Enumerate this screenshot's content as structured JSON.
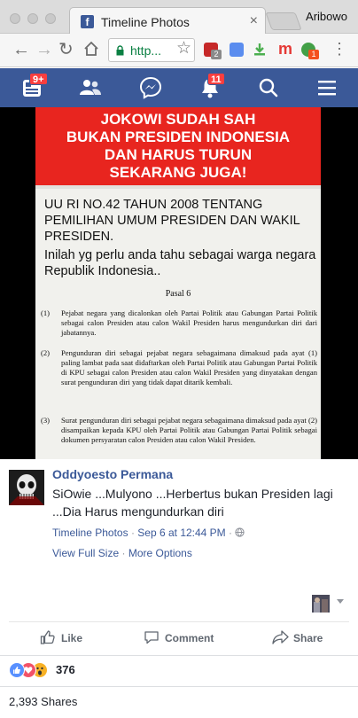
{
  "browser": {
    "tab_title": "Timeline Photos",
    "tab_favicon": "f",
    "profile_name": "Aribowo",
    "url_text": "http...",
    "extension_badges": [
      "2",
      "1"
    ]
  },
  "fbnav": {
    "home_badge": "9+",
    "notifications_badge": "11"
  },
  "photo": {
    "banner_lines": [
      "JOKOWI SUDAH SAH",
      "BUKAN PRESIDEN INDONESIA",
      "DAN HARUS TURUN",
      "SEKARANG JUGA!"
    ],
    "law_title": "UU RI NO.42 TAHUN 2008 TENTANG PEMILIHAN UMUM PRESIDEN DAN WAKIL PRESIDEN.",
    "law_subtitle": "Inilah yg perlu anda tahu sebagai warga negara Republik Indonesia..",
    "pasal": "Pasal 6",
    "clauses": [
      {
        "num": "(1)",
        "text": "Pejabat negara yang dicalonkan oleh Partai Politik atau Gabungan Partai Politik sebagai calon Presiden atau calon Wakil Presiden harus mengundurkan diri dari jabatannya."
      },
      {
        "num": "(2)",
        "text": "Pengunduran diri sebagai pejabat negara sebagaimana dimaksud pada ayat (1) paling lambat pada saat didaftarkan oleh Partai Politik atau Gabungan Partai Politik di KPU sebagai calon Presiden atau calon Wakil Presiden yang dinyatakan dengan surat pengunduran diri yang tidak dapat ditarik kembali."
      },
      {
        "num": "(3)",
        "text": "Surat pengunduran diri sebagai pejabat negara sebagaimana dimaksud pada ayat (2) disampaikan kepada KPU oleh Partai Politik atau Gabungan Partai Politik sebagai dokumen persyaratan calon Presiden atau calon Wakil Presiden."
      }
    ]
  },
  "post": {
    "author": "Oddyoesto Permana",
    "caption": "SiOwie ...Mulyono ...Herbertus bukan Presiden lagi ...Dia Harus mengundurkan diri",
    "album": "Timeline Photos",
    "separator": "·",
    "date": "Sep 6 at 12:44 PM",
    "privacy_icon": "globe-icon",
    "view_full_size": "View Full Size",
    "more_options": "More Options",
    "actions": {
      "like": "Like",
      "comment": "Comment",
      "share": "Share"
    },
    "reaction_count": "376",
    "shares": "2,393 Shares"
  },
  "colors": {
    "facebook_blue": "#3b5998",
    "banner_red": "#e8251f",
    "notification_red": "#fa3e3e"
  }
}
